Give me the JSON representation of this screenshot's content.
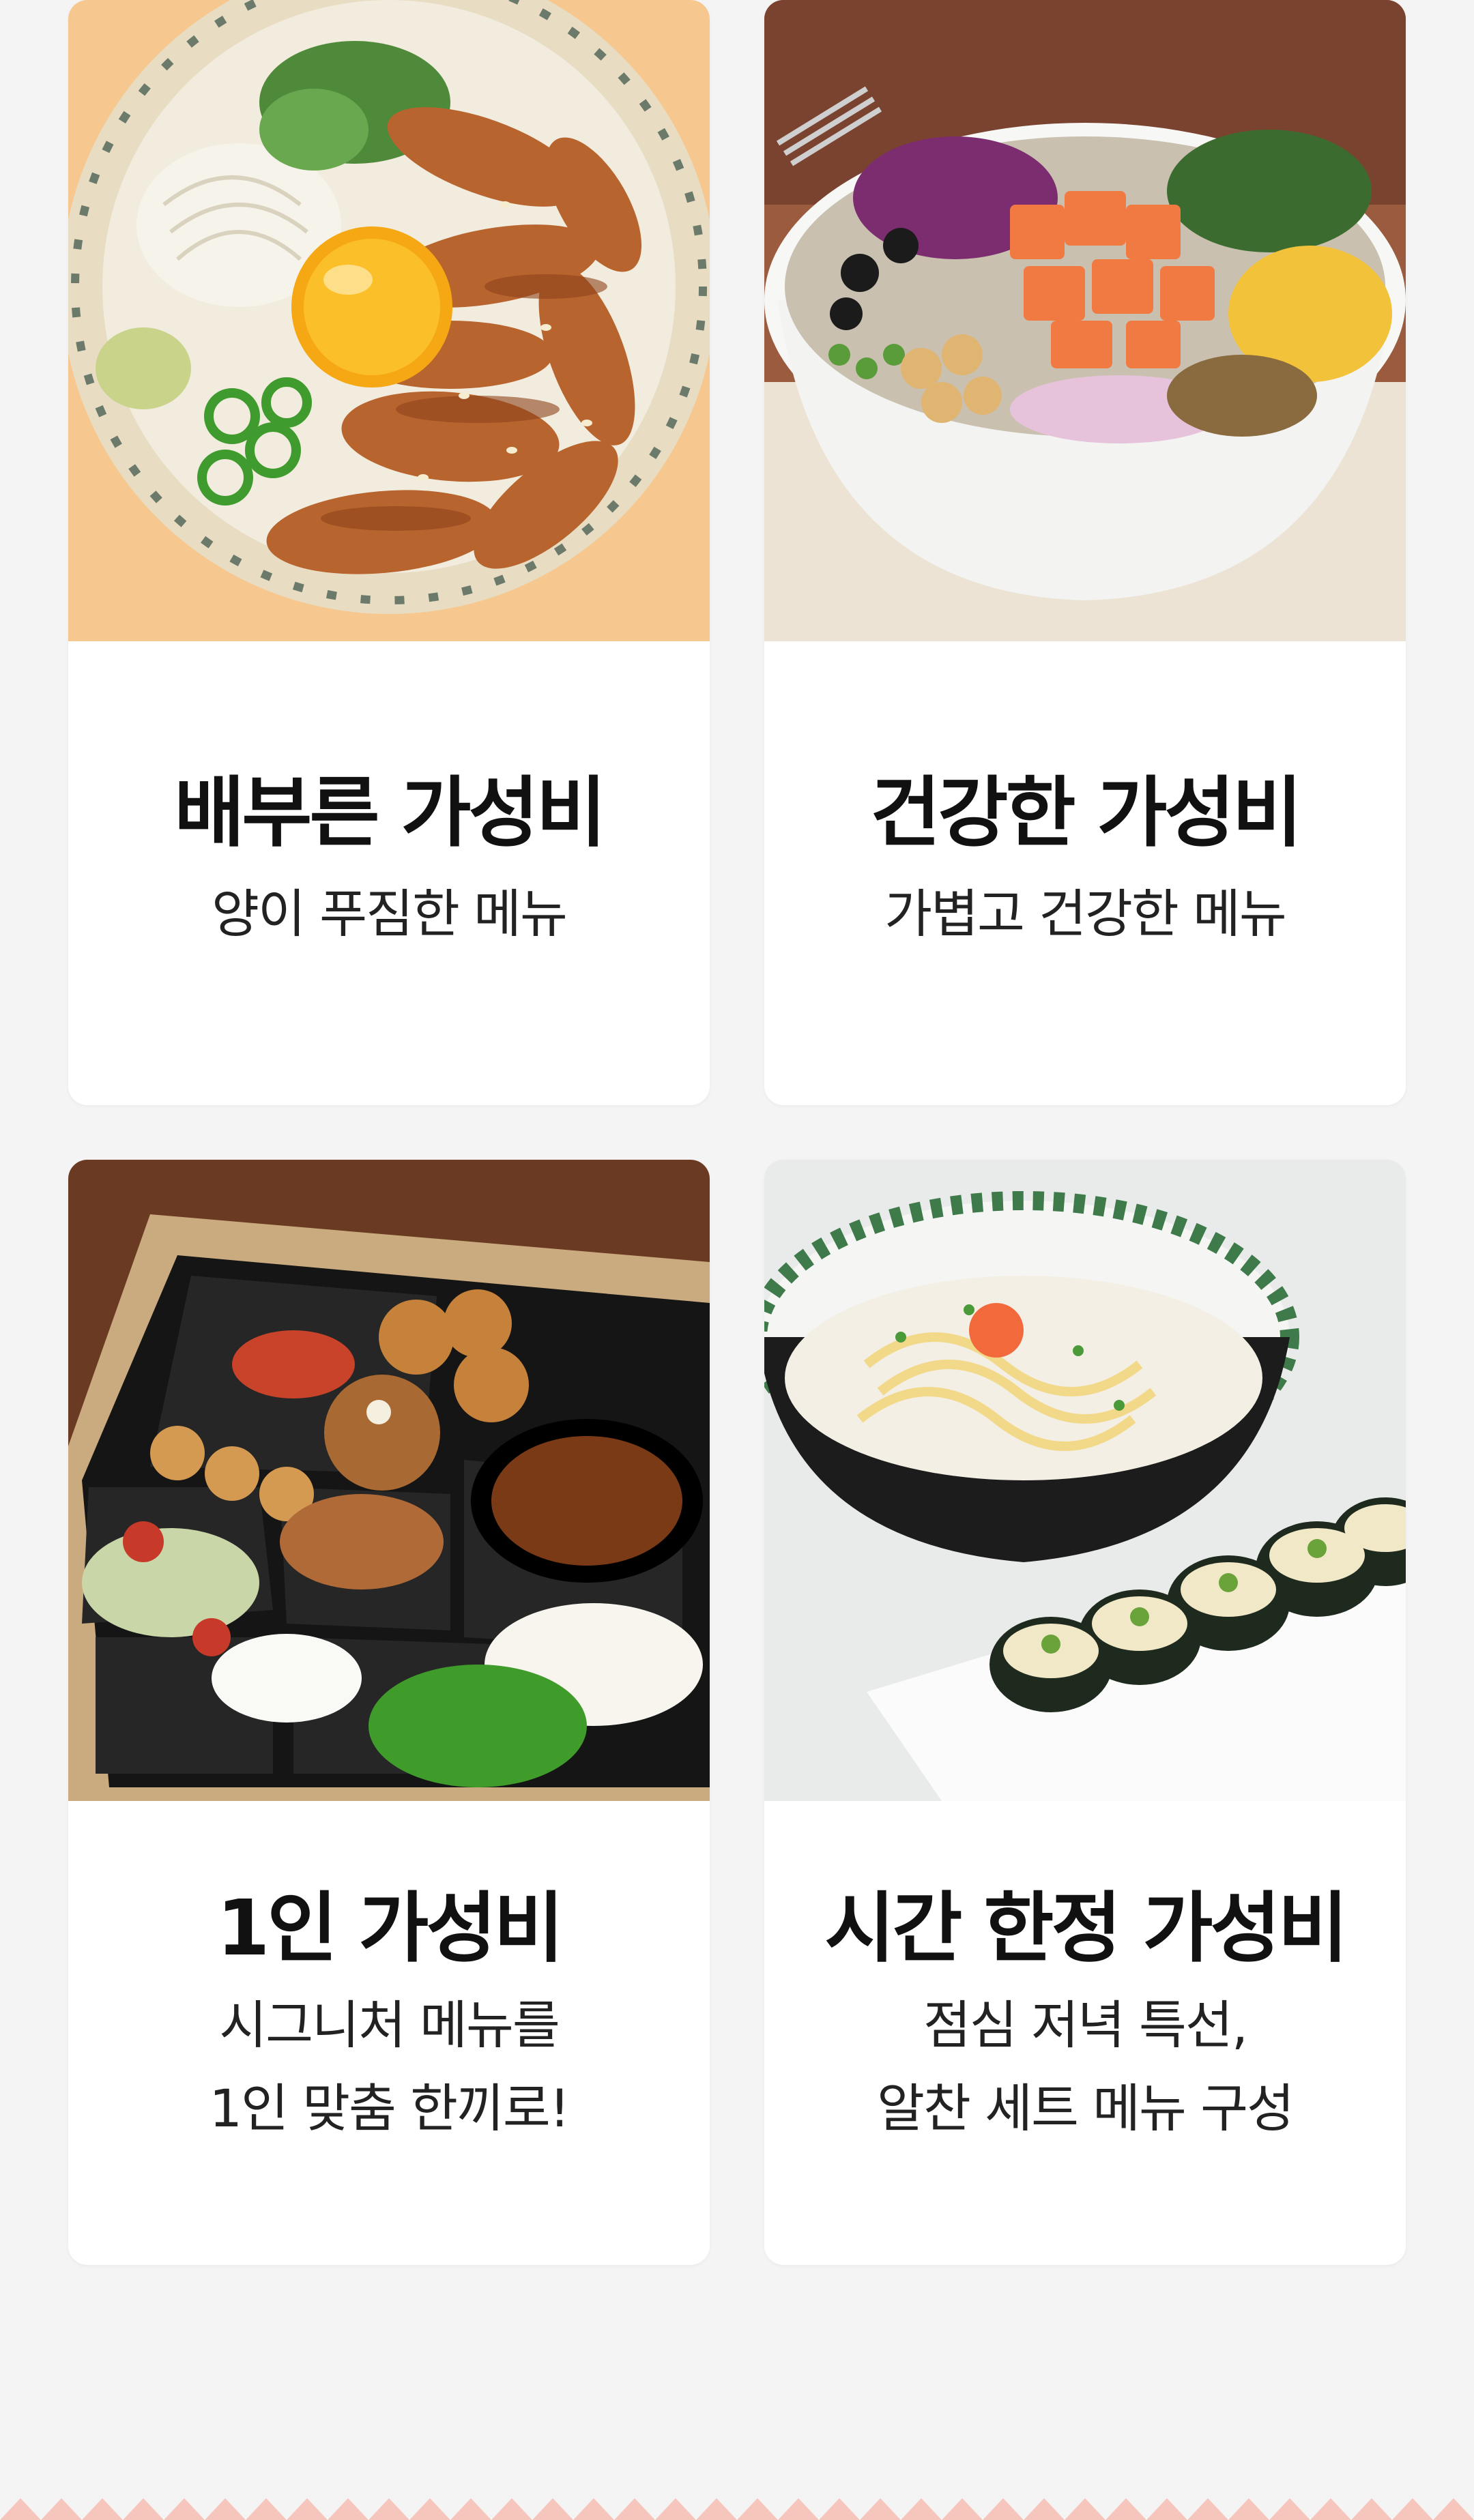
{
  "colors": {
    "page_background": "#f4f4f4",
    "card_background": "#ffffff",
    "title_text": "#111111",
    "desc_text": "#222222",
    "bottom_zigzag": "#f6c6bd"
  },
  "cards": [
    {
      "title": "배부른 가성비",
      "desc_lines": [
        "양이 푸짐한 메뉴"
      ],
      "image": "pork-rice-bowl-with-egg-yolk"
    },
    {
      "title": "건강한 가성비",
      "desc_lines": [
        "가볍고 건강한 메뉴"
      ],
      "image": "salmon-poke-bowl"
    },
    {
      "title": "1인 가성비",
      "desc_lines": [
        "시그니처 메뉴를",
        "1인 맞춤 한끼로!"
      ],
      "image": "single-serving-lunchbox"
    },
    {
      "title": "시간 한정 가성비",
      "desc_lines": [
        "점심 저녁 특선,",
        "알찬 세트 메뉴 구성"
      ],
      "image": "cream-udon-and-kimbap-set"
    }
  ]
}
